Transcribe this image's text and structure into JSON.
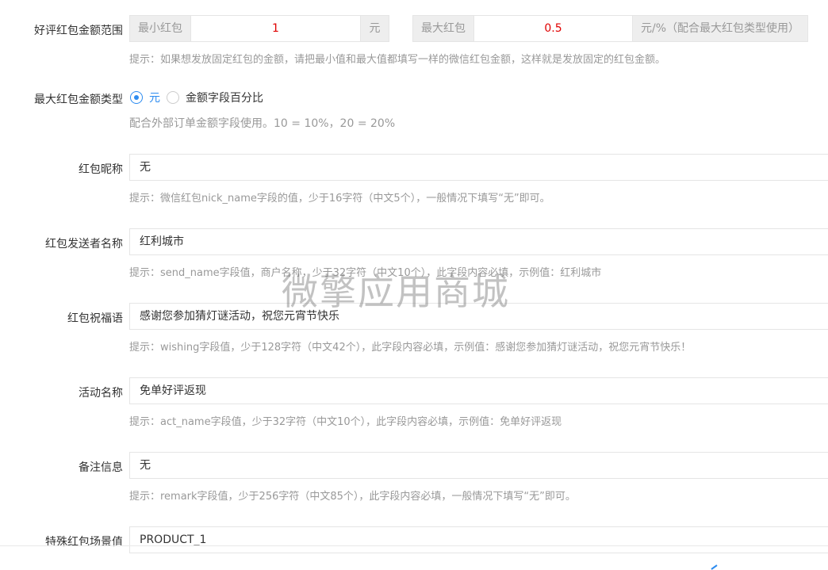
{
  "range": {
    "label": "好评红包金额范围",
    "min_label": "最小红包",
    "min_value": "1",
    "min_unit": "元",
    "max_label": "最大红包",
    "max_value": "0.5",
    "max_unit": "元/%（配合最大红包类型使用）",
    "hint": "提示：如果想发放固定红包的金额，请把最小值和最大值都填写一样的微信红包金额，这样就是发放固定的红包金额。"
  },
  "max_type": {
    "label": "最大红包金额类型",
    "options": [
      {
        "label": "元",
        "selected": true
      },
      {
        "label": "金额字段百分比",
        "selected": false
      }
    ],
    "hint": "配合外部订单金额字段使用。10 = 10%，20 = 20%"
  },
  "nick_name": {
    "label": "红包昵称",
    "value": "无",
    "hint": "提示：微信红包nick_name字段的值，少于16字符（中文5个），一般情况下填写“无”即可。"
  },
  "send_name": {
    "label": "红包发送者名称",
    "value": "红利城市",
    "hint": "提示：send_name字段值，商户名称，少于32字符（中文10个），此字段内容必填，示例值：红利城市"
  },
  "wishing": {
    "label": "红包祝福语",
    "value": "感谢您参加猜灯谜活动，祝您元宵节快乐",
    "hint": "提示：wishing字段值，少于128字符（中文42个），此字段内容必填，示例值：感谢您参加猜灯谜活动，祝您元宵节快乐！"
  },
  "act_name": {
    "label": "活动名称",
    "value": "免单好评返现",
    "hint": "提示：act_name字段值，少于32字符（中文10个），此字段内容必填，示例值：免单好评返现"
  },
  "remark": {
    "label": "备注信息",
    "value": "无",
    "hint": "提示：remark字段值，少于256字符（中文85个），此字段内容必填，一般情况下填写“无”即可。"
  },
  "scene": {
    "label": "特殊红包场景值",
    "value": "PRODUCT_1"
  },
  "watermark": "微擎应用商城"
}
